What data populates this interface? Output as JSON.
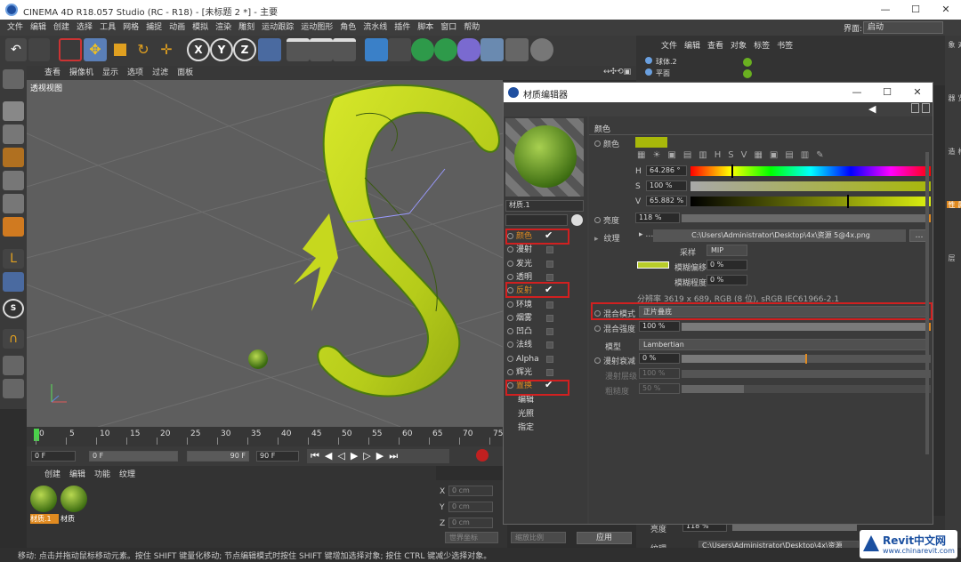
{
  "app": {
    "title": "CINEMA 4D R18.057 Studio (RC - R18) - [未标题 2 *] - 主要",
    "interface_label": "界面:",
    "interface_value": "启动"
  },
  "menu": [
    "文件",
    "编辑",
    "创建",
    "选择",
    "工具",
    "网格",
    "捕捉",
    "动画",
    "模拟",
    "渲染",
    "雕刻",
    "运动跟踪",
    "运动图形",
    "角色",
    "流水线",
    "插件",
    "脚本",
    "窗口",
    "帮助"
  ],
  "toolbar": {
    "x": "X",
    "y": "Y",
    "z": "Z"
  },
  "viewport": {
    "menu": [
      "查看",
      "摄像机",
      "显示",
      "选项",
      "过滤",
      "面板"
    ],
    "label": "透视视图"
  },
  "timeline": {
    "ticks": [
      "0",
      "5",
      "10",
      "15",
      "20",
      "25",
      "30",
      "35",
      "40",
      "45",
      "50",
      "55",
      "60",
      "65",
      "70",
      "75"
    ],
    "start": "0 F",
    "start2": "0 F",
    "end": "90 F",
    "end2": "90 F"
  },
  "materials": {
    "menu": [
      "创建",
      "编辑",
      "功能",
      "纹理"
    ],
    "items": [
      "材质.1",
      "材质"
    ]
  },
  "coords": {
    "x": "X",
    "y": "Y",
    "z": "Z",
    "xv": "0 cm",
    "yv": "0 cm",
    "zv": "0 cm",
    "mode": "世界坐标",
    "scale": "缩放比例",
    "apply": "应用"
  },
  "status": "移动: 点击并拖动鼠标移动元素。按住 SHIFT 键量化移动; 节点编辑模式时按住 SHIFT 键增加选择对象; 按住 CTRL 键减少选择对象。",
  "objmgr": {
    "menu": [
      "文件",
      "编辑",
      "查看",
      "对象",
      "标签",
      "书签"
    ],
    "items": [
      "球体.2",
      "平面"
    ]
  },
  "attr_bottom": {
    "brightness_label": "亮度",
    "brightness": "118 %",
    "texture_label": "纹理",
    "texture": "C:\\Users\\Administrator\\Desktop\\4x\\资源"
  },
  "right_tabs": [
    "对象",
    "内容浏览器",
    "构造",
    "属性",
    "层"
  ],
  "dialog": {
    "title": "材质编辑器",
    "mat_name": "材质.1",
    "channels": [
      {
        "name": "颜色",
        "checked": true
      },
      {
        "name": "漫射",
        "checked": false
      },
      {
        "name": "发光",
        "checked": false
      },
      {
        "name": "透明",
        "checked": false
      },
      {
        "name": "反射",
        "checked": true
      },
      {
        "name": "环境",
        "checked": false
      },
      {
        "name": "烟雾",
        "checked": false
      },
      {
        "name": "凹凸",
        "checked": false
      },
      {
        "name": "法线",
        "checked": false
      },
      {
        "name": "Alpha",
        "checked": false
      },
      {
        "name": "辉光",
        "checked": false
      },
      {
        "name": "置换",
        "checked": true
      }
    ],
    "extra": [
      "编辑",
      "光照",
      "指定"
    ],
    "section": "颜色",
    "color_label": "颜色",
    "swatch": "#a8b80a",
    "h_label": "H",
    "h_value": "64.286 °",
    "s_label": "S",
    "s_value": "100 %",
    "v_label": "V",
    "v_value": "65.882 %",
    "brightness_label": "亮度",
    "brightness_value": "118 %",
    "texture_label": "纹理",
    "texture_path": "C:\\Users\\Administrator\\Desktop\\4x\\资源 5@4x.png",
    "sampling_label": "采样",
    "sampling_value": "MIP",
    "blur_offset_label": "模糊偏移",
    "blur_offset_value": "0 %",
    "blur_scale_label": "模糊程度",
    "blur_scale_value": "0 %",
    "resolution": "分辨率 3619 x 689, RGB (8 位), sRGB IEC61966-2.1",
    "mix_mode_label": "混合模式",
    "mix_mode_value": "正片叠底",
    "mix_strength_label": "混合强度",
    "mix_strength_value": "100 %",
    "model_label": "模型",
    "model_value": "Lambertian",
    "diffuse_falloff_label": "漫射衰减",
    "diffuse_falloff_value": "0 %",
    "diffuse_level_label": "漫射层级",
    "diffuse_level_value": "100 %",
    "roughness_label": "粗糙度",
    "roughness_value": "50 %"
  },
  "watermark": {
    "brand": "Revit中文网",
    "url": "www.chinarevit.com"
  }
}
